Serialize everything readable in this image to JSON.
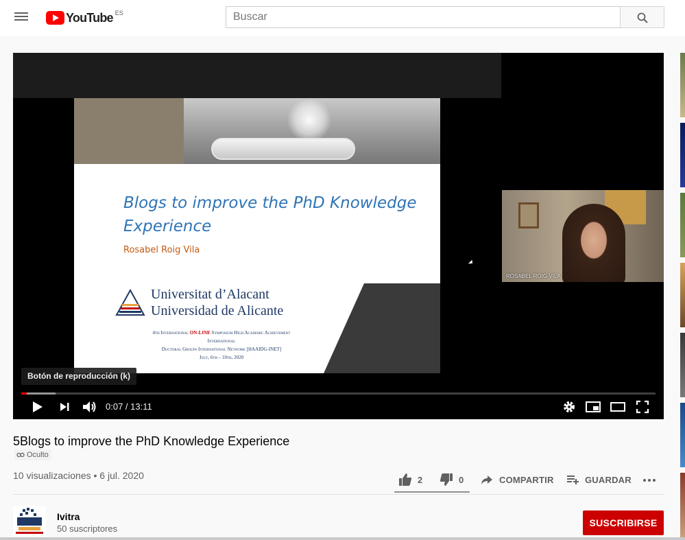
{
  "masthead": {
    "logo_text": "YouTube",
    "country_code": "ES",
    "search_placeholder": "Buscar"
  },
  "player": {
    "slide": {
      "title": "Blogs to improve the PhD Knowledge Experience",
      "author": "Rosabel Roig Vila",
      "university_line1": "Universitat d’Alacant",
      "university_line2": "Universidad de Alicante",
      "info_line1_pre": "4th International",
      "info_line1_red": "ON-LINE",
      "info_line1_post": "Symposium High Academic Achievement",
      "info_line2": "International",
      "info_line3": "Doctoral Groups International Network [HAAIDG-INET]",
      "info_line4": "July, 6th – 10th, 2020"
    },
    "webcam_name": "ROSABEL ROIG VILA",
    "tooltip": "Botón de reproducción (k)",
    "current_time": "0:07",
    "duration": "13:11",
    "time_display": "0:07 / 13:11",
    "progress_fraction": 0.0089,
    "buffered_fraction": 0.054
  },
  "video": {
    "title": "5Blogs to improve the PhD Knowledge Experience",
    "privacy": "Oculto",
    "meta": "10 visualizaciones • 6 jul. 2020",
    "likes": "2",
    "dislikes": "0",
    "share_label": "COMPARTIR",
    "save_label": "GUARDAR",
    "like_ratio": 1.0
  },
  "channel": {
    "name": "Ivitra",
    "subscribers": "50 suscriptores",
    "subscribe_label": "SUSCRIBIRSE"
  },
  "colors": {
    "brand_red": "#ff0000",
    "subscribe_red": "#cc0000",
    "slide_title_blue": "#2e74b5",
    "slide_author_orange": "#c55a11"
  },
  "icons": [
    "menu-icon",
    "search-icon",
    "play-icon",
    "next-icon",
    "volume-icon",
    "settings-icon",
    "miniplayer-icon",
    "theater-icon",
    "fullscreen-icon",
    "like-icon",
    "dislike-icon",
    "share-icon",
    "save-playlist-icon",
    "more-icon",
    "link-icon"
  ]
}
